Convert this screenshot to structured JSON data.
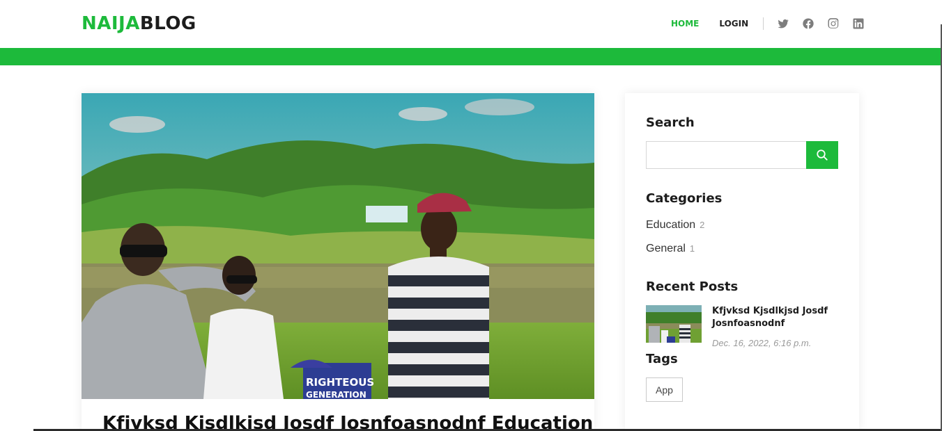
{
  "brand": {
    "part1": "NAIJA",
    "part2": "BLOG"
  },
  "nav": {
    "home": "HOME",
    "login": "LOGIN",
    "social": [
      "twitter-icon",
      "facebook-icon",
      "instagram-icon",
      "linkedin-icon"
    ]
  },
  "colors": {
    "accent": "#1dba3b",
    "text": "#1c1c1c",
    "muted": "#9a9a9a"
  },
  "post": {
    "title": "Kfjvksd Kjsdlkjsd Josdf Josnfoasnodnf Education ll",
    "image_sign_line1": "RIGHTEOUS",
    "image_sign_line2": "GENERATION"
  },
  "sidebar": {
    "search_heading": "Search",
    "search_placeholder": "",
    "categories_heading": "Categories",
    "categories": [
      {
        "name": "Education",
        "count": "2"
      },
      {
        "name": "General",
        "count": "1"
      }
    ],
    "recent_heading": "Recent Posts",
    "recent": [
      {
        "title": "Kfjvksd Kjsdlkjsd Josdf Josnfoasnodnf",
        "date": "Dec. 16, 2022, 6:16 p.m."
      }
    ],
    "tags_heading": "Tags",
    "tags": [
      "App"
    ]
  }
}
